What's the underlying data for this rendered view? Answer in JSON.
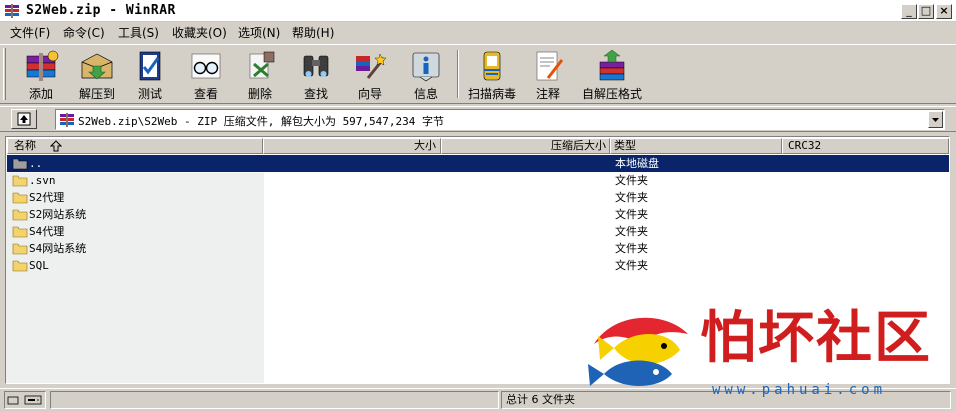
{
  "window": {
    "title": "S2Web.zip - WinRAR",
    "minimize": "_",
    "maximize": "□",
    "close": "×"
  },
  "menu": [
    {
      "label": "文件(F)"
    },
    {
      "label": "命令(C)"
    },
    {
      "label": "工具(S)"
    },
    {
      "label": "收藏夹(O)"
    },
    {
      "label": "选项(N)"
    },
    {
      "label": "帮助(H)"
    }
  ],
  "toolbar": {
    "buttons": [
      {
        "label": "添加",
        "icon": "add-books-icon"
      },
      {
        "label": "解压到",
        "icon": "extract-to-icon"
      },
      {
        "label": "测试",
        "icon": "test-icon"
      },
      {
        "label": "查看",
        "icon": "view-glasses-icon"
      },
      {
        "label": "删除",
        "icon": "delete-icon"
      },
      {
        "label": "查找",
        "icon": "find-binoculars-icon"
      },
      {
        "label": "向导",
        "icon": "wizard-icon"
      },
      {
        "label": "信息",
        "icon": "info-icon"
      },
      {
        "label": "扫描病毒",
        "icon": "virus-scan-icon"
      },
      {
        "label": "注释",
        "icon": "comment-icon"
      },
      {
        "label": "自解压格式",
        "icon": "sfx-icon"
      }
    ]
  },
  "address": {
    "path": "S2Web.zip\\S2Web - ZIP 压缩文件, 解包大小为 597,547,234 字节"
  },
  "columns": {
    "name": "名称",
    "size": "大小",
    "packed": "压缩后大小",
    "type": "类型",
    "crc": "CRC32"
  },
  "files": [
    {
      "name": "..",
      "type": "本地磁盘",
      "selected": true
    },
    {
      "name": ".svn",
      "type": "文件夹"
    },
    {
      "name": "S2代理",
      "type": "文件夹"
    },
    {
      "name": "S2网站系统",
      "type": "文件夹"
    },
    {
      "name": "S4代理",
      "type": "文件夹"
    },
    {
      "name": "S4网站系统",
      "type": "文件夹"
    },
    {
      "name": "SQL",
      "type": "文件夹"
    }
  ],
  "status": {
    "summary": "总计 6 文件夹"
  },
  "watermark": {
    "brand": "怕坏社区",
    "url": "www.pahuai.com"
  },
  "colors": {
    "selection": "#0a246a",
    "face": "#d4d0c8",
    "watermark_red": "#d01e1e",
    "watermark_blue": "#1f64b8"
  }
}
